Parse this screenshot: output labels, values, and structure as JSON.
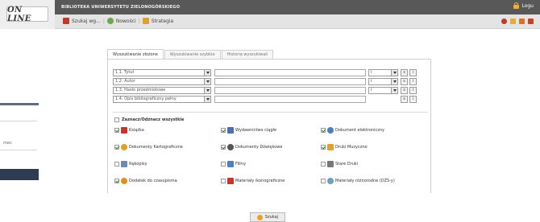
{
  "header": {
    "logo_text": "ON LINE",
    "library_title": "BIBLIOTEKA UNIWERSYTETU ZIELONOGÓRSKIEGO",
    "login_label": "Logu"
  },
  "nav": {
    "items": [
      {
        "label": "Szukaj wg...",
        "icon": "book-icon",
        "color": "#c0392b"
      },
      {
        "label": "Nowości",
        "icon": "star-icon",
        "color": "#6aa84f"
      },
      {
        "label": "Strategia",
        "icon": "strategy-icon",
        "color": "#e0a030"
      }
    ],
    "separator": "|",
    "tools": [
      {
        "icon": "basket-icon",
        "color": "#c0392b"
      },
      {
        "icon": "edit-icon",
        "color": "#e0b030"
      },
      {
        "icon": "save-icon",
        "color": "#e07020"
      },
      {
        "icon": "close-icon",
        "color": "#d04020"
      }
    ]
  },
  "sidebar": {
    "text": "mec"
  },
  "tabs": [
    {
      "label": "Wyszukiwanie złożone",
      "active": true
    },
    {
      "label": "Wyszukiwanie szybkie",
      "active": false
    },
    {
      "label": "Historia wyszukiwań",
      "active": false
    }
  ],
  "search_rows": [
    {
      "field": "1.1. Tytuł",
      "value": "",
      "operator": "i",
      "has_operator": true
    },
    {
      "field": "1.2. Autor",
      "value": "",
      "operator": "i",
      "has_operator": true
    },
    {
      "field": "1.3. Hasło przedmiotowe",
      "value": "",
      "operator": "i",
      "has_operator": true
    },
    {
      "field": "1.4. Opis bibliograficzny pełny",
      "value": "",
      "operator": "",
      "has_operator": false
    }
  ],
  "row_buttons": {
    "s": "s",
    "i": "i"
  },
  "toggle_all_label": "Zaznacz/Odznacz wszystkie",
  "doc_types": [
    {
      "label": "Książka",
      "checked": true,
      "icon": "book-icon",
      "color": "#c0392b"
    },
    {
      "label": "Wydawnictwo ciągłe",
      "checked": true,
      "icon": "periodical-icon",
      "color": "#4a6fb0"
    },
    {
      "label": "Dokument elektroniczny",
      "checked": true,
      "icon": "electronic-doc-icon",
      "color": "#4a7fc0"
    },
    {
      "label": "Dokumenty Kartograficzne",
      "checked": true,
      "icon": "globe-icon",
      "color": "#e0a030"
    },
    {
      "label": "Dokumenty Dźwiękowe",
      "checked": true,
      "icon": "audio-icon",
      "color": "#555555"
    },
    {
      "label": "Druki Muzyczne",
      "checked": true,
      "icon": "music-icon",
      "color": "#e0a030"
    },
    {
      "label": "Rękopisy",
      "checked": false,
      "icon": "manuscript-icon",
      "color": "#6a8ab0"
    },
    {
      "label": "Filmy",
      "checked": false,
      "icon": "film-icon",
      "color": "#4a7fc0"
    },
    {
      "label": "Stare Druki",
      "checked": false,
      "icon": "old-print-icon",
      "color": "#777777"
    },
    {
      "label": "Dodatek do czasopisma",
      "checked": true,
      "icon": "supplement-icon",
      "color": "#e09020"
    },
    {
      "label": "Materiały ikonograficzne",
      "checked": false,
      "icon": "iconographic-icon",
      "color": "#c0392b"
    },
    {
      "label": "Materiały różnorodne (DŻS-y)",
      "checked": false,
      "icon": "mixed-materials-icon",
      "color": "#6aa0c0"
    }
  ],
  "search_button_label": "Szukaj"
}
